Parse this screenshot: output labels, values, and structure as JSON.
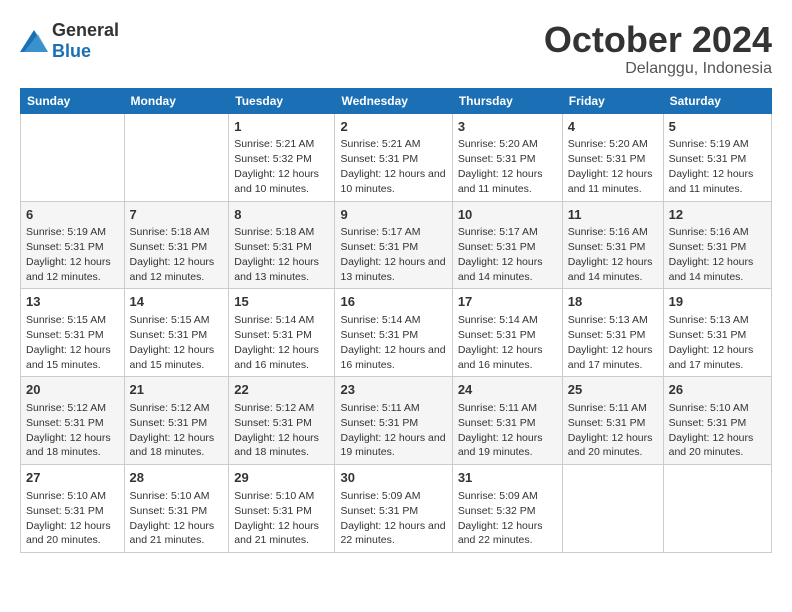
{
  "logo": {
    "general": "General",
    "blue": "Blue"
  },
  "header": {
    "month": "October 2024",
    "location": "Delanggu, Indonesia"
  },
  "weekdays": [
    "Sunday",
    "Monday",
    "Tuesday",
    "Wednesday",
    "Thursday",
    "Friday",
    "Saturday"
  ],
  "weeks": [
    [
      {
        "day": "",
        "sunrise": "",
        "sunset": "",
        "daylight": ""
      },
      {
        "day": "",
        "sunrise": "",
        "sunset": "",
        "daylight": ""
      },
      {
        "day": "1",
        "sunrise": "Sunrise: 5:21 AM",
        "sunset": "Sunset: 5:32 PM",
        "daylight": "Daylight: 12 hours and 10 minutes."
      },
      {
        "day": "2",
        "sunrise": "Sunrise: 5:21 AM",
        "sunset": "Sunset: 5:31 PM",
        "daylight": "Daylight: 12 hours and 10 minutes."
      },
      {
        "day": "3",
        "sunrise": "Sunrise: 5:20 AM",
        "sunset": "Sunset: 5:31 PM",
        "daylight": "Daylight: 12 hours and 11 minutes."
      },
      {
        "day": "4",
        "sunrise": "Sunrise: 5:20 AM",
        "sunset": "Sunset: 5:31 PM",
        "daylight": "Daylight: 12 hours and 11 minutes."
      },
      {
        "day": "5",
        "sunrise": "Sunrise: 5:19 AM",
        "sunset": "Sunset: 5:31 PM",
        "daylight": "Daylight: 12 hours and 11 minutes."
      }
    ],
    [
      {
        "day": "6",
        "sunrise": "Sunrise: 5:19 AM",
        "sunset": "Sunset: 5:31 PM",
        "daylight": "Daylight: 12 hours and 12 minutes."
      },
      {
        "day": "7",
        "sunrise": "Sunrise: 5:18 AM",
        "sunset": "Sunset: 5:31 PM",
        "daylight": "Daylight: 12 hours and 12 minutes."
      },
      {
        "day": "8",
        "sunrise": "Sunrise: 5:18 AM",
        "sunset": "Sunset: 5:31 PM",
        "daylight": "Daylight: 12 hours and 13 minutes."
      },
      {
        "day": "9",
        "sunrise": "Sunrise: 5:17 AM",
        "sunset": "Sunset: 5:31 PM",
        "daylight": "Daylight: 12 hours and 13 minutes."
      },
      {
        "day": "10",
        "sunrise": "Sunrise: 5:17 AM",
        "sunset": "Sunset: 5:31 PM",
        "daylight": "Daylight: 12 hours and 14 minutes."
      },
      {
        "day": "11",
        "sunrise": "Sunrise: 5:16 AM",
        "sunset": "Sunset: 5:31 PM",
        "daylight": "Daylight: 12 hours and 14 minutes."
      },
      {
        "day": "12",
        "sunrise": "Sunrise: 5:16 AM",
        "sunset": "Sunset: 5:31 PM",
        "daylight": "Daylight: 12 hours and 14 minutes."
      }
    ],
    [
      {
        "day": "13",
        "sunrise": "Sunrise: 5:15 AM",
        "sunset": "Sunset: 5:31 PM",
        "daylight": "Daylight: 12 hours and 15 minutes."
      },
      {
        "day": "14",
        "sunrise": "Sunrise: 5:15 AM",
        "sunset": "Sunset: 5:31 PM",
        "daylight": "Daylight: 12 hours and 15 minutes."
      },
      {
        "day": "15",
        "sunrise": "Sunrise: 5:14 AM",
        "sunset": "Sunset: 5:31 PM",
        "daylight": "Daylight: 12 hours and 16 minutes."
      },
      {
        "day": "16",
        "sunrise": "Sunrise: 5:14 AM",
        "sunset": "Sunset: 5:31 PM",
        "daylight": "Daylight: 12 hours and 16 minutes."
      },
      {
        "day": "17",
        "sunrise": "Sunrise: 5:14 AM",
        "sunset": "Sunset: 5:31 PM",
        "daylight": "Daylight: 12 hours and 16 minutes."
      },
      {
        "day": "18",
        "sunrise": "Sunrise: 5:13 AM",
        "sunset": "Sunset: 5:31 PM",
        "daylight": "Daylight: 12 hours and 17 minutes."
      },
      {
        "day": "19",
        "sunrise": "Sunrise: 5:13 AM",
        "sunset": "Sunset: 5:31 PM",
        "daylight": "Daylight: 12 hours and 17 minutes."
      }
    ],
    [
      {
        "day": "20",
        "sunrise": "Sunrise: 5:12 AM",
        "sunset": "Sunset: 5:31 PM",
        "daylight": "Daylight: 12 hours and 18 minutes."
      },
      {
        "day": "21",
        "sunrise": "Sunrise: 5:12 AM",
        "sunset": "Sunset: 5:31 PM",
        "daylight": "Daylight: 12 hours and 18 minutes."
      },
      {
        "day": "22",
        "sunrise": "Sunrise: 5:12 AM",
        "sunset": "Sunset: 5:31 PM",
        "daylight": "Daylight: 12 hours and 18 minutes."
      },
      {
        "day": "23",
        "sunrise": "Sunrise: 5:11 AM",
        "sunset": "Sunset: 5:31 PM",
        "daylight": "Daylight: 12 hours and 19 minutes."
      },
      {
        "day": "24",
        "sunrise": "Sunrise: 5:11 AM",
        "sunset": "Sunset: 5:31 PM",
        "daylight": "Daylight: 12 hours and 19 minutes."
      },
      {
        "day": "25",
        "sunrise": "Sunrise: 5:11 AM",
        "sunset": "Sunset: 5:31 PM",
        "daylight": "Daylight: 12 hours and 20 minutes."
      },
      {
        "day": "26",
        "sunrise": "Sunrise: 5:10 AM",
        "sunset": "Sunset: 5:31 PM",
        "daylight": "Daylight: 12 hours and 20 minutes."
      }
    ],
    [
      {
        "day": "27",
        "sunrise": "Sunrise: 5:10 AM",
        "sunset": "Sunset: 5:31 PM",
        "daylight": "Daylight: 12 hours and 20 minutes."
      },
      {
        "day": "28",
        "sunrise": "Sunrise: 5:10 AM",
        "sunset": "Sunset: 5:31 PM",
        "daylight": "Daylight: 12 hours and 21 minutes."
      },
      {
        "day": "29",
        "sunrise": "Sunrise: 5:10 AM",
        "sunset": "Sunset: 5:31 PM",
        "daylight": "Daylight: 12 hours and 21 minutes."
      },
      {
        "day": "30",
        "sunrise": "Sunrise: 5:09 AM",
        "sunset": "Sunset: 5:31 PM",
        "daylight": "Daylight: 12 hours and 22 minutes."
      },
      {
        "day": "31",
        "sunrise": "Sunrise: 5:09 AM",
        "sunset": "Sunset: 5:32 PM",
        "daylight": "Daylight: 12 hours and 22 minutes."
      },
      {
        "day": "",
        "sunrise": "",
        "sunset": "",
        "daylight": ""
      },
      {
        "day": "",
        "sunrise": "",
        "sunset": "",
        "daylight": ""
      }
    ]
  ]
}
